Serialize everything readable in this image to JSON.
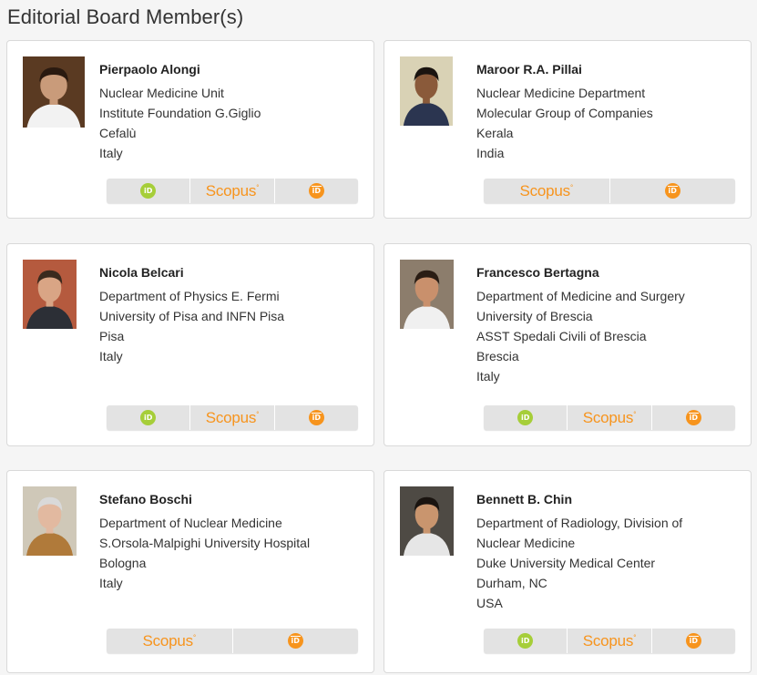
{
  "heading": "Editorial Board Member(s)",
  "colors": {
    "orcid": "#a6ce39",
    "scopus": "#f7941d",
    "researcherid": "#f7941d"
  },
  "icons": {
    "orcid_text": "iD",
    "scopus_text": "Scopus",
    "scopus_mark": "°",
    "rid_text": "iD"
  },
  "members": [
    {
      "name": "Pierpaolo Alongi",
      "lines": [
        "Nuclear Medicine Unit",
        "Institute Foundation G.Giglio",
        "Cefalù",
        "Italy"
      ],
      "links": [
        "orcid",
        "scopus",
        "researcherid"
      ]
    },
    {
      "name": "Maroor R.A. Pillai",
      "lines": [
        "Nuclear Medicine Department",
        "Molecular Group of Companies",
        "Kerala",
        "India"
      ],
      "links": [
        "scopus",
        "researcherid"
      ]
    },
    {
      "name": "Nicola Belcari",
      "lines": [
        "Department of Physics E. Fermi",
        "University of Pisa and INFN Pisa",
        "Pisa",
        "Italy"
      ],
      "links": [
        "orcid",
        "scopus",
        "researcherid"
      ]
    },
    {
      "name": "Francesco Bertagna",
      "lines": [
        "Department of Medicine and Surgery",
        "University of Brescia",
        "ASST Spedali Civili of Brescia",
        "Brescia",
        "Italy"
      ],
      "links": [
        "orcid",
        "scopus",
        "researcherid"
      ]
    },
    {
      "name": "Stefano Boschi",
      "lines": [
        "Department of Nuclear Medicine",
        "S.Orsola-Malpighi University Hospital",
        "Bologna",
        "Italy"
      ],
      "links": [
        "scopus",
        "researcherid"
      ]
    },
    {
      "name": "Bennett B. Chin",
      "lines": [
        "Department of Radiology, Division of",
        "Nuclear Medicine",
        "Duke University Medical Center",
        "Durham, NC",
        "USA"
      ],
      "links": [
        "orcid",
        "scopus",
        "researcherid"
      ]
    }
  ]
}
